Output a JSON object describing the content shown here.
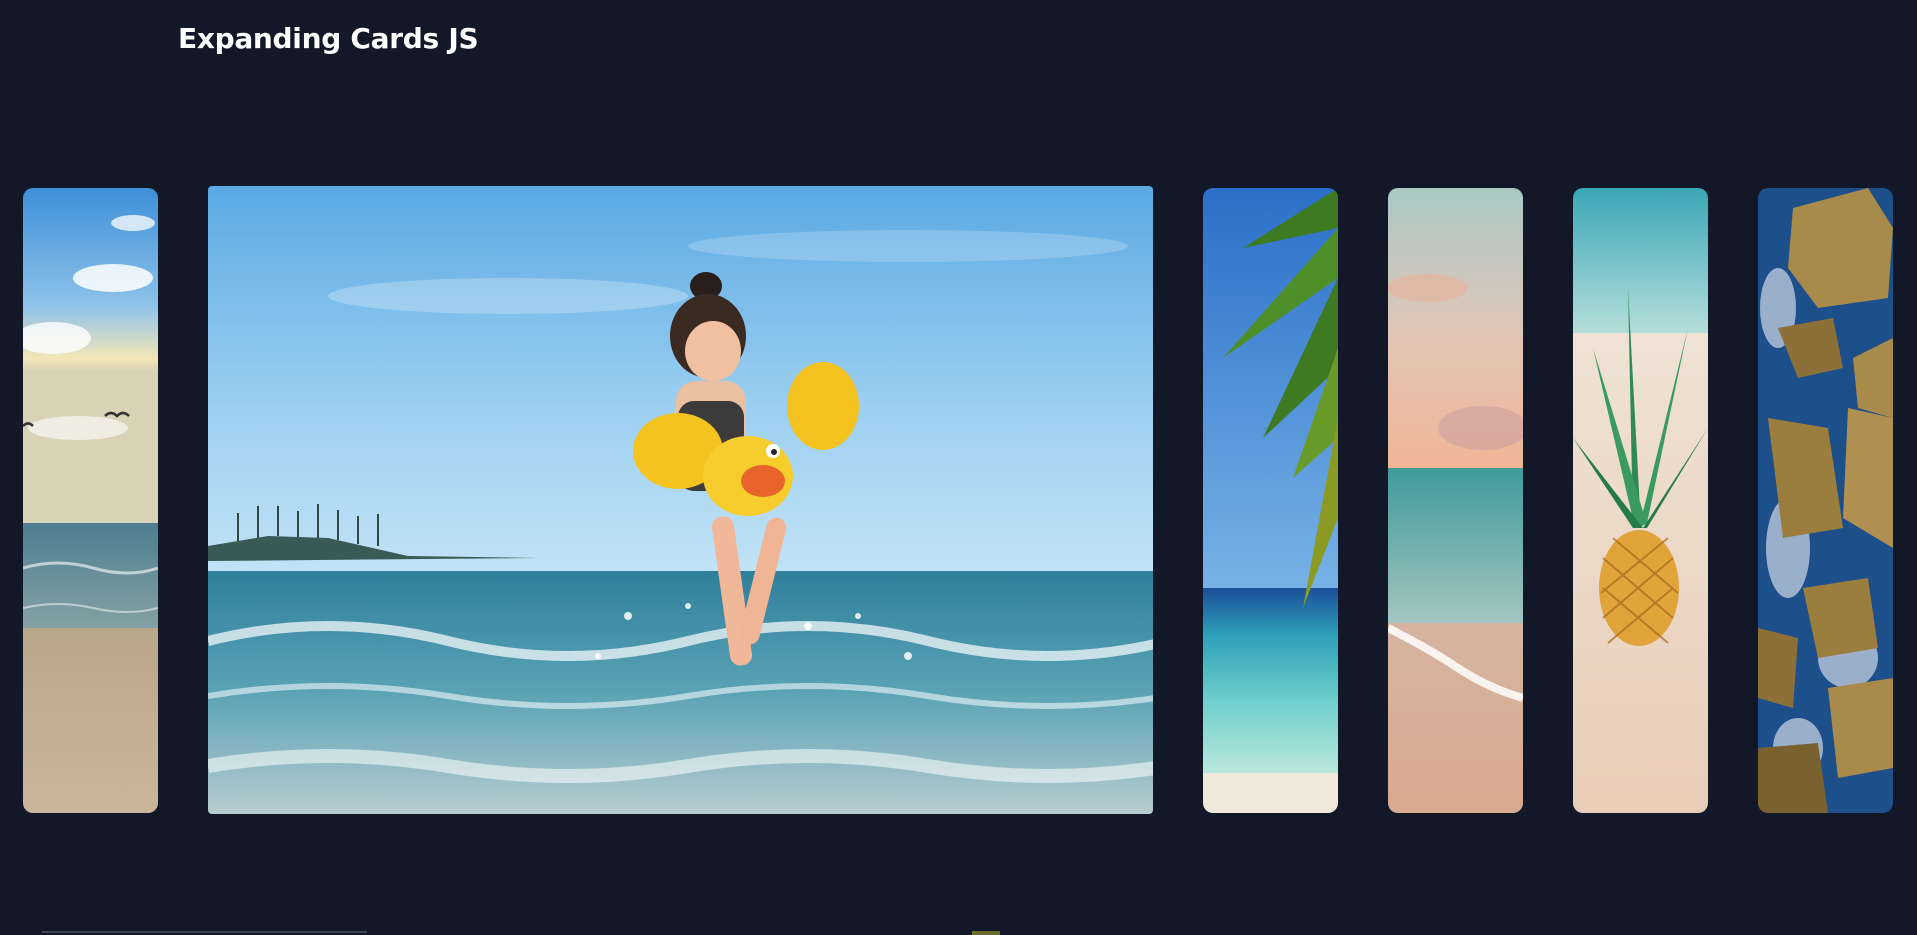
{
  "header": {
    "title": "Expanding Cards JS"
  },
  "cards": [
    {
      "caption": "",
      "scene": "sky-sunset-beach-with-birds",
      "active": false
    },
    {
      "caption": "",
      "scene": "girl-in-duck-floaties-splashing-in-waves",
      "active": true
    },
    {
      "caption": "",
      "scene": "palm-tree-over-turquoise-sea",
      "active": false
    },
    {
      "caption": "",
      "scene": "pastel-sunset-shoreline",
      "active": false
    },
    {
      "caption": "",
      "scene": "pineapple-on-sand",
      "active": false
    },
    {
      "caption": "",
      "scene": "wet-rocks-in-surf",
      "active": false
    }
  ],
  "colors": {
    "background": "#121827",
    "title_text": "#ffffff",
    "sky_blue": "#5ab0e6",
    "sea_teal": "#3c9ab0",
    "sand": "#d9b99a"
  }
}
